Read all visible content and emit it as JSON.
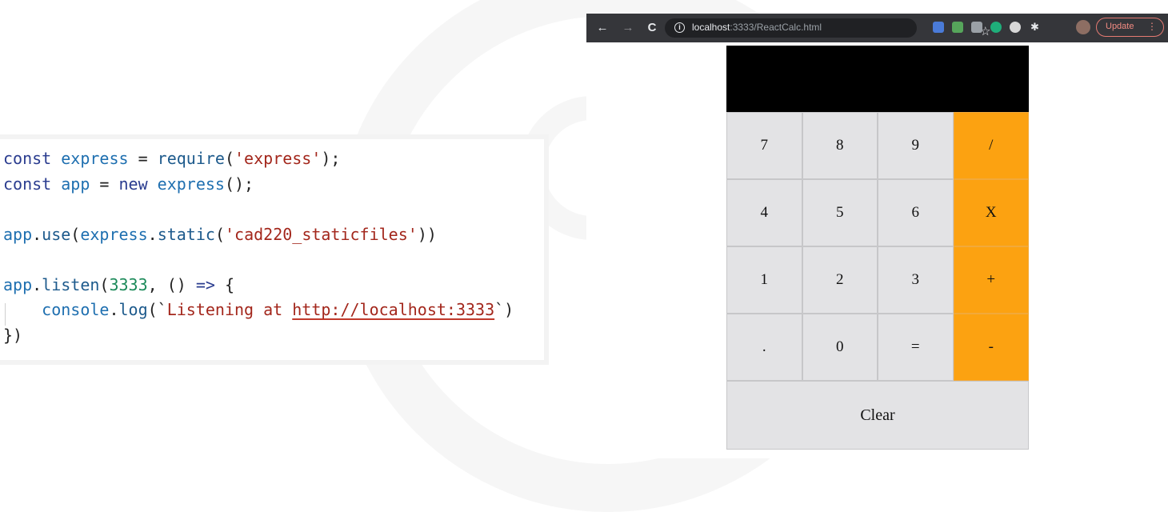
{
  "code": {
    "lines": [
      [
        {
          "t": "const ",
          "c": "kw"
        },
        {
          "t": "express",
          "c": "var"
        },
        {
          "t": " = ",
          "c": ""
        },
        {
          "t": "require",
          "c": "fn"
        },
        {
          "t": "(",
          "c": ""
        },
        {
          "t": "'express'",
          "c": "str"
        },
        {
          "t": ");",
          "c": ""
        }
      ],
      [
        {
          "t": "const ",
          "c": "kw"
        },
        {
          "t": "app",
          "c": "var"
        },
        {
          "t": " = ",
          "c": ""
        },
        {
          "t": "new ",
          "c": "kw"
        },
        {
          "t": "express",
          "c": "var"
        },
        {
          "t": "();",
          "c": ""
        }
      ],
      [],
      [
        {
          "t": "app",
          "c": "var"
        },
        {
          "t": ".",
          "c": ""
        },
        {
          "t": "use",
          "c": "fn"
        },
        {
          "t": "(",
          "c": ""
        },
        {
          "t": "express",
          "c": "var"
        },
        {
          "t": ".",
          "c": ""
        },
        {
          "t": "static",
          "c": "fn"
        },
        {
          "t": "(",
          "c": ""
        },
        {
          "t": "'cad220_staticfiles'",
          "c": "str"
        },
        {
          "t": "))",
          "c": ""
        }
      ],
      [],
      [
        {
          "t": "app",
          "c": "var"
        },
        {
          "t": ".",
          "c": ""
        },
        {
          "t": "listen",
          "c": "fn"
        },
        {
          "t": "(",
          "c": ""
        },
        {
          "t": "3333",
          "c": "num"
        },
        {
          "t": ", () ",
          "c": ""
        },
        {
          "t": "=>",
          "c": "kw"
        },
        {
          "t": " {",
          "c": ""
        }
      ],
      [
        {
          "t": "    console",
          "c": "var"
        },
        {
          "t": ".",
          "c": ""
        },
        {
          "t": "log",
          "c": "fn"
        },
        {
          "t": "(`",
          "c": ""
        },
        {
          "t": "Listening at ",
          "c": "str"
        },
        {
          "t": "http://localhost:3333",
          "c": "url"
        },
        {
          "t": "`)",
          "c": ""
        }
      ],
      [
        {
          "t": "})",
          "c": ""
        }
      ]
    ]
  },
  "browser": {
    "url_host": "localhost",
    "url_rest": ":3333/ReactCalc.html",
    "update_label": "Update",
    "update_menu": "⋮",
    "back_glyph": "←",
    "forward_glyph": "→",
    "reload_glyph": "C",
    "star_glyph": "☆",
    "info_glyph": "i"
  },
  "calculator": {
    "display": "",
    "keys": [
      {
        "label": "7",
        "type": "num"
      },
      {
        "label": "8",
        "type": "num"
      },
      {
        "label": "9",
        "type": "num"
      },
      {
        "label": "/",
        "type": "op"
      },
      {
        "label": "4",
        "type": "num"
      },
      {
        "label": "5",
        "type": "num"
      },
      {
        "label": "6",
        "type": "num"
      },
      {
        "label": "X",
        "type": "op"
      },
      {
        "label": "1",
        "type": "num"
      },
      {
        "label": "2",
        "type": "num"
      },
      {
        "label": "3",
        "type": "num"
      },
      {
        "label": "+",
        "type": "op"
      },
      {
        "label": ".",
        "type": "num"
      },
      {
        "label": "0",
        "type": "num"
      },
      {
        "label": "=",
        "type": "num"
      },
      {
        "label": "-",
        "type": "op"
      }
    ],
    "clear_label": "Clear"
  },
  "colors": {
    "operator_key": "#fca211",
    "number_key": "#e3e3e5",
    "display_bg": "#000000",
    "toolbar_bg": "#35363a"
  }
}
